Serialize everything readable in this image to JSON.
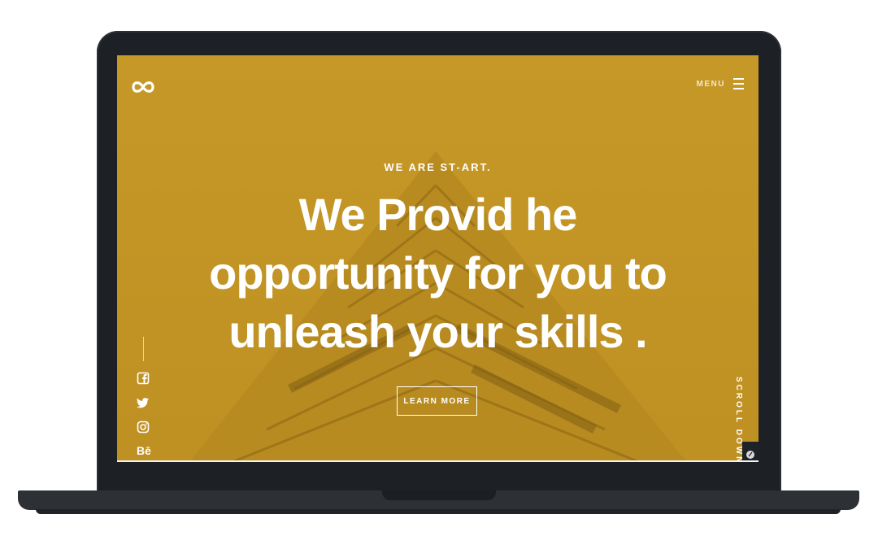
{
  "header": {
    "logo_icon": "infinity-icon",
    "menu_label": "MENU",
    "menu_icon": "hamburger-icon"
  },
  "hero": {
    "eyebrow": "WE ARE ST-ART.",
    "headline_lines": [
      "We Provid he",
      "opportunity for you to",
      "unleash your skills ."
    ],
    "cta_label": "LEARN MORE"
  },
  "social": {
    "items": [
      {
        "icon": "facebook-icon"
      },
      {
        "icon": "twitter-icon"
      },
      {
        "icon": "instagram-icon"
      },
      {
        "icon": "behance-icon",
        "label": "Bē"
      }
    ]
  },
  "scroll": {
    "label": "SCROLL DOWN"
  },
  "colors": {
    "accent": "#c49625",
    "text": "#ffffff",
    "device_frame": "#1d2126"
  }
}
